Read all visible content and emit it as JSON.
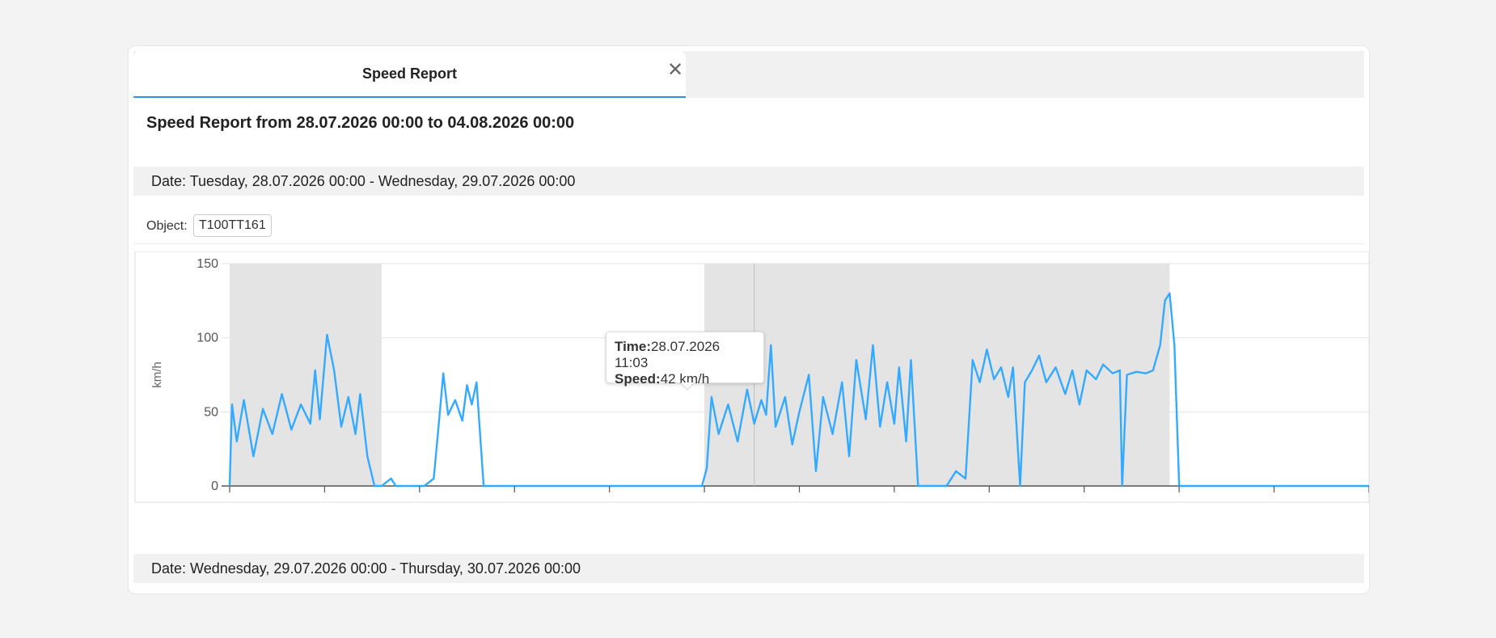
{
  "tab": {
    "label": "Speed Report",
    "close_label": "✕"
  },
  "report_title": "Speed Report from 28.07.2026 00:00 to 04.08.2026 00:00",
  "date_rows": [
    "Date: Tuesday, 28.07.2026 00:00 - Wednesday, 29.07.2026 00:00",
    "Date: Wednesday, 29.07.2026 00:00 - Thursday, 30.07.2026 00:00"
  ],
  "object": {
    "label": "Object:",
    "value": "T100TT161"
  },
  "tooltip": {
    "time_label": "Time:",
    "time_value": "28.07.2026 11:03",
    "speed_label": "Speed:",
    "speed_value": "42 km/h"
  },
  "colors": {
    "line": "#33aaff",
    "band": "#e4e4e4",
    "accent": "#2f8fe0"
  },
  "chart_data": {
    "type": "line",
    "ylabel": "km/h",
    "ylim": [
      0,
      150
    ],
    "yticks": [
      0,
      50,
      100,
      150
    ],
    "xlim": [
      0,
      24
    ],
    "shaded_ranges": [
      [
        0,
        3.2
      ],
      [
        10,
        19.8
      ]
    ],
    "series": [
      {
        "values": [
          [
            0.0,
            0
          ],
          [
            0.05,
            55
          ],
          [
            0.15,
            30
          ],
          [
            0.3,
            58
          ],
          [
            0.5,
            20
          ],
          [
            0.7,
            52
          ],
          [
            0.9,
            35
          ],
          [
            1.1,
            62
          ],
          [
            1.3,
            38
          ],
          [
            1.5,
            55
          ],
          [
            1.7,
            42
          ],
          [
            1.8,
            78
          ],
          [
            1.9,
            45
          ],
          [
            2.05,
            102
          ],
          [
            2.2,
            78
          ],
          [
            2.35,
            40
          ],
          [
            2.5,
            60
          ],
          [
            2.65,
            35
          ],
          [
            2.75,
            62
          ],
          [
            2.9,
            20
          ],
          [
            3.05,
            0
          ],
          [
            3.2,
            0
          ],
          [
            3.4,
            5
          ],
          [
            3.5,
            0
          ],
          [
            4.1,
            0
          ],
          [
            4.3,
            5
          ],
          [
            4.4,
            40
          ],
          [
            4.5,
            76
          ],
          [
            4.6,
            48
          ],
          [
            4.75,
            58
          ],
          [
            4.9,
            44
          ],
          [
            5.0,
            68
          ],
          [
            5.1,
            55
          ],
          [
            5.2,
            70
          ],
          [
            5.35,
            0
          ],
          [
            6,
            0
          ],
          [
            9.95,
            0
          ],
          [
            10.05,
            12
          ],
          [
            10.15,
            60
          ],
          [
            10.3,
            35
          ],
          [
            10.5,
            55
          ],
          [
            10.7,
            30
          ],
          [
            10.9,
            65
          ],
          [
            11.05,
            42
          ],
          [
            11.2,
            58
          ],
          [
            11.3,
            48
          ],
          [
            11.4,
            95
          ],
          [
            11.5,
            40
          ],
          [
            11.7,
            60
          ],
          [
            11.85,
            28
          ],
          [
            12.0,
            50
          ],
          [
            12.2,
            75
          ],
          [
            12.35,
            10
          ],
          [
            12.5,
            60
          ],
          [
            12.7,
            35
          ],
          [
            12.9,
            70
          ],
          [
            13.05,
            20
          ],
          [
            13.2,
            85
          ],
          [
            13.4,
            45
          ],
          [
            13.55,
            95
          ],
          [
            13.7,
            40
          ],
          [
            13.85,
            70
          ],
          [
            14.0,
            42
          ],
          [
            14.1,
            80
          ],
          [
            14.25,
            30
          ],
          [
            14.35,
            85
          ],
          [
            14.5,
            0
          ],
          [
            14.7,
            0
          ],
          [
            15.1,
            0
          ],
          [
            15.3,
            10
          ],
          [
            15.5,
            5
          ],
          [
            15.65,
            85
          ],
          [
            15.8,
            70
          ],
          [
            15.95,
            92
          ],
          [
            16.1,
            72
          ],
          [
            16.25,
            80
          ],
          [
            16.4,
            60
          ],
          [
            16.5,
            80
          ],
          [
            16.65,
            0
          ],
          [
            16.75,
            70
          ],
          [
            16.9,
            78
          ],
          [
            17.05,
            88
          ],
          [
            17.2,
            70
          ],
          [
            17.4,
            80
          ],
          [
            17.6,
            62
          ],
          [
            17.75,
            78
          ],
          [
            17.9,
            55
          ],
          [
            18.05,
            78
          ],
          [
            18.25,
            72
          ],
          [
            18.4,
            82
          ],
          [
            18.6,
            76
          ],
          [
            18.75,
            78
          ],
          [
            18.8,
            0
          ],
          [
            18.9,
            75
          ],
          [
            19.1,
            77
          ],
          [
            19.3,
            76
          ],
          [
            19.45,
            78
          ],
          [
            19.6,
            95
          ],
          [
            19.7,
            125
          ],
          [
            19.8,
            130
          ],
          [
            19.9,
            95
          ],
          [
            20.0,
            0
          ],
          [
            24,
            0
          ]
        ]
      }
    ]
  }
}
